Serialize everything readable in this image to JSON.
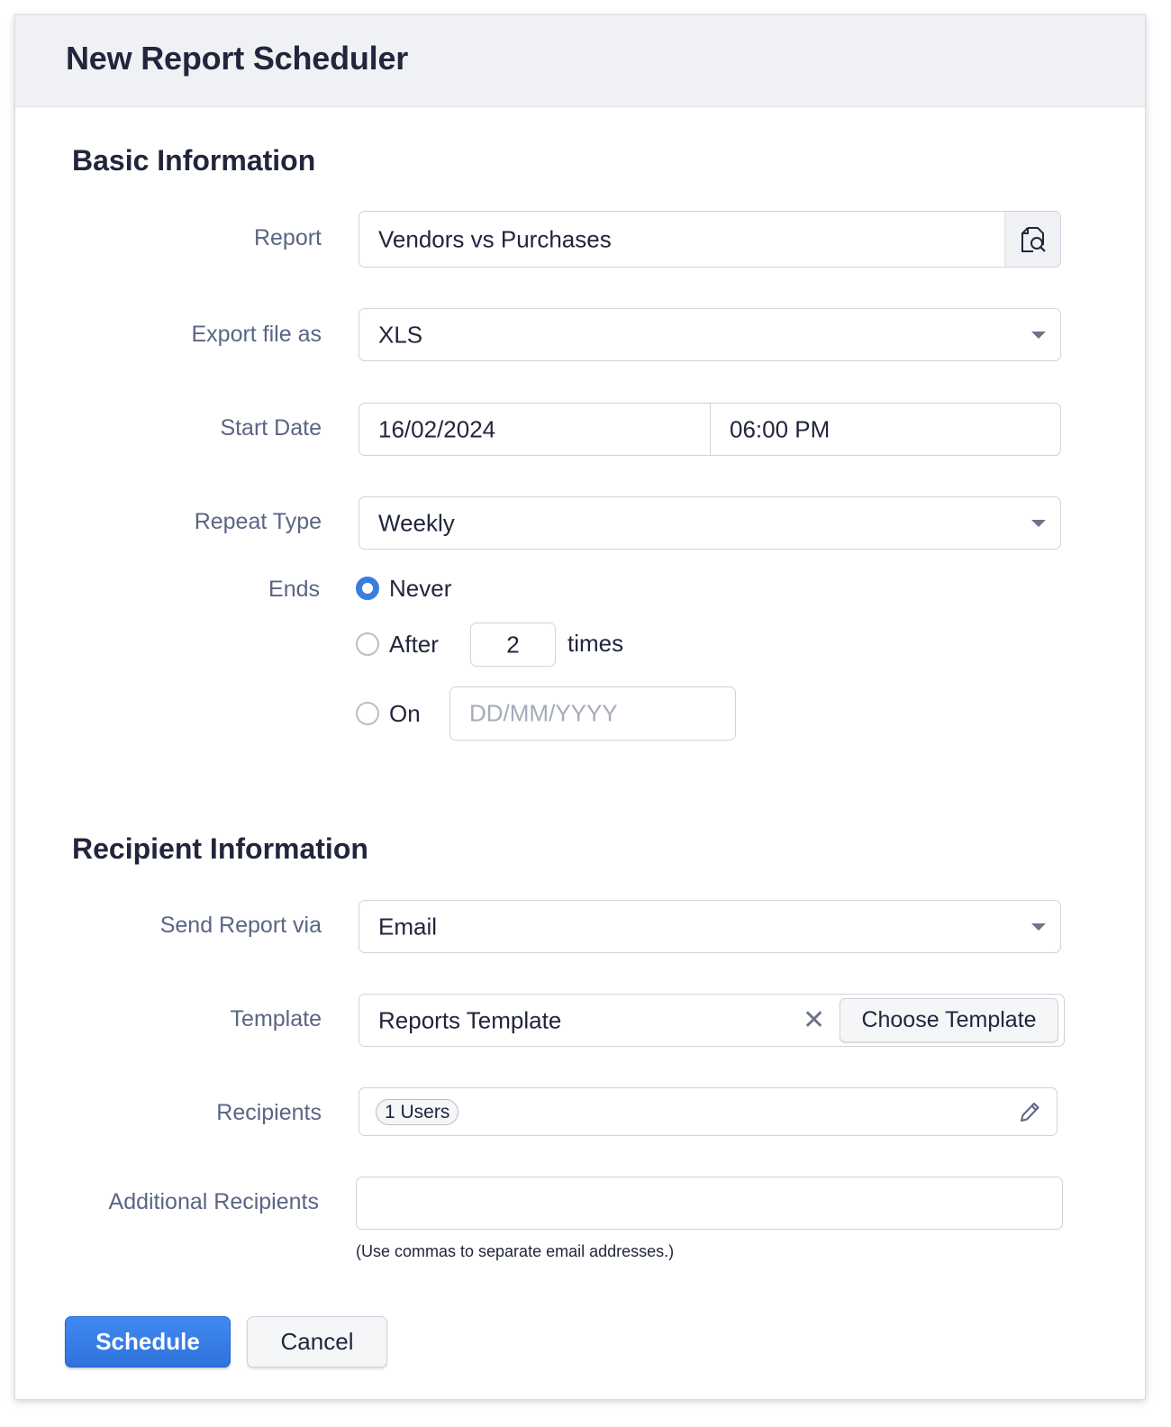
{
  "dialog": {
    "title": "New Report Scheduler"
  },
  "basic": {
    "section_title": "Basic Information",
    "report": {
      "label": "Report",
      "value": "Vendors vs Purchases",
      "icon": "report-search-icon"
    },
    "export": {
      "label": "Export file as",
      "value": "XLS"
    },
    "start_date": {
      "label": "Start Date",
      "date": "16/02/2024",
      "time": "06:00 PM"
    },
    "repeat": {
      "label": "Repeat Type",
      "value": "Weekly"
    },
    "ends": {
      "label": "Ends",
      "never_label": "Never",
      "after_label": "After",
      "after_count": "2",
      "times_label": "times",
      "on_label": "On",
      "on_placeholder": "DD/MM/YYYY",
      "selected": "Never"
    }
  },
  "recipient": {
    "section_title": "Recipient Information",
    "send_via": {
      "label": "Send Report via",
      "value": "Email"
    },
    "template": {
      "label": "Template",
      "value": "Reports Template",
      "clear_icon": "close-icon",
      "choose_label": "Choose Template"
    },
    "recipients": {
      "label": "Recipients",
      "chip": "1 Users",
      "edit_icon": "pencil-icon"
    },
    "additional": {
      "label": "Additional Recipients",
      "value": "",
      "hint": "(Use commas to separate email addresses.)"
    }
  },
  "actions": {
    "schedule_label": "Schedule",
    "cancel_label": "Cancel"
  },
  "colors": {
    "accent": "#3a7de0",
    "header_bg": "#f0f1f4",
    "label_text": "#5b6584"
  }
}
